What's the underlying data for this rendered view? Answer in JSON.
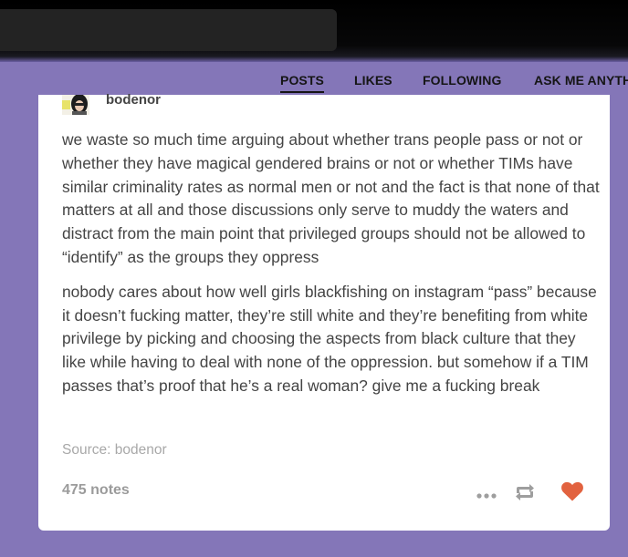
{
  "nav": {
    "tabs": [
      {
        "label": "POSTS",
        "active": true
      },
      {
        "label": "LIKES",
        "active": false
      },
      {
        "label": "FOLLOWING",
        "active": false
      },
      {
        "label": "ASK ME ANYTHING",
        "active": false
      }
    ]
  },
  "post": {
    "username": "bodenor",
    "paragraphs": [
      "we waste so much time arguing about whether trans people pass or not or whether they have magical gendered brains or not or whether TIMs have similar criminality rates as normal men or not and the fact is that none of that matters at all and those discussions only serve to muddy the waters and distract from the main point that privileged groups should not be allowed to “identify” as the groups they oppress",
      "nobody cares about how well girls blackfishing on instagram “pass” because it doesn’t fucking matter, they’re still white and they’re benefiting from white privilege by picking and choosing the aspects from black culture that they like while having to deal with none of the oppression. but somehow if a TIM passes that’s proof that he’s a real woman? give me a fucking break"
    ],
    "source": "Source: bodenor",
    "notes": "475 notes"
  },
  "icons": {
    "more": "more-dots-icon",
    "reblog": "reblog-icon",
    "like": "heart-icon"
  },
  "colors": {
    "background": "#8476b8",
    "card": "#ffffff",
    "text": "#444444",
    "muted": "#a8a8a8",
    "heart": "#e2623f",
    "icon_gray": "#9e9e9e"
  }
}
